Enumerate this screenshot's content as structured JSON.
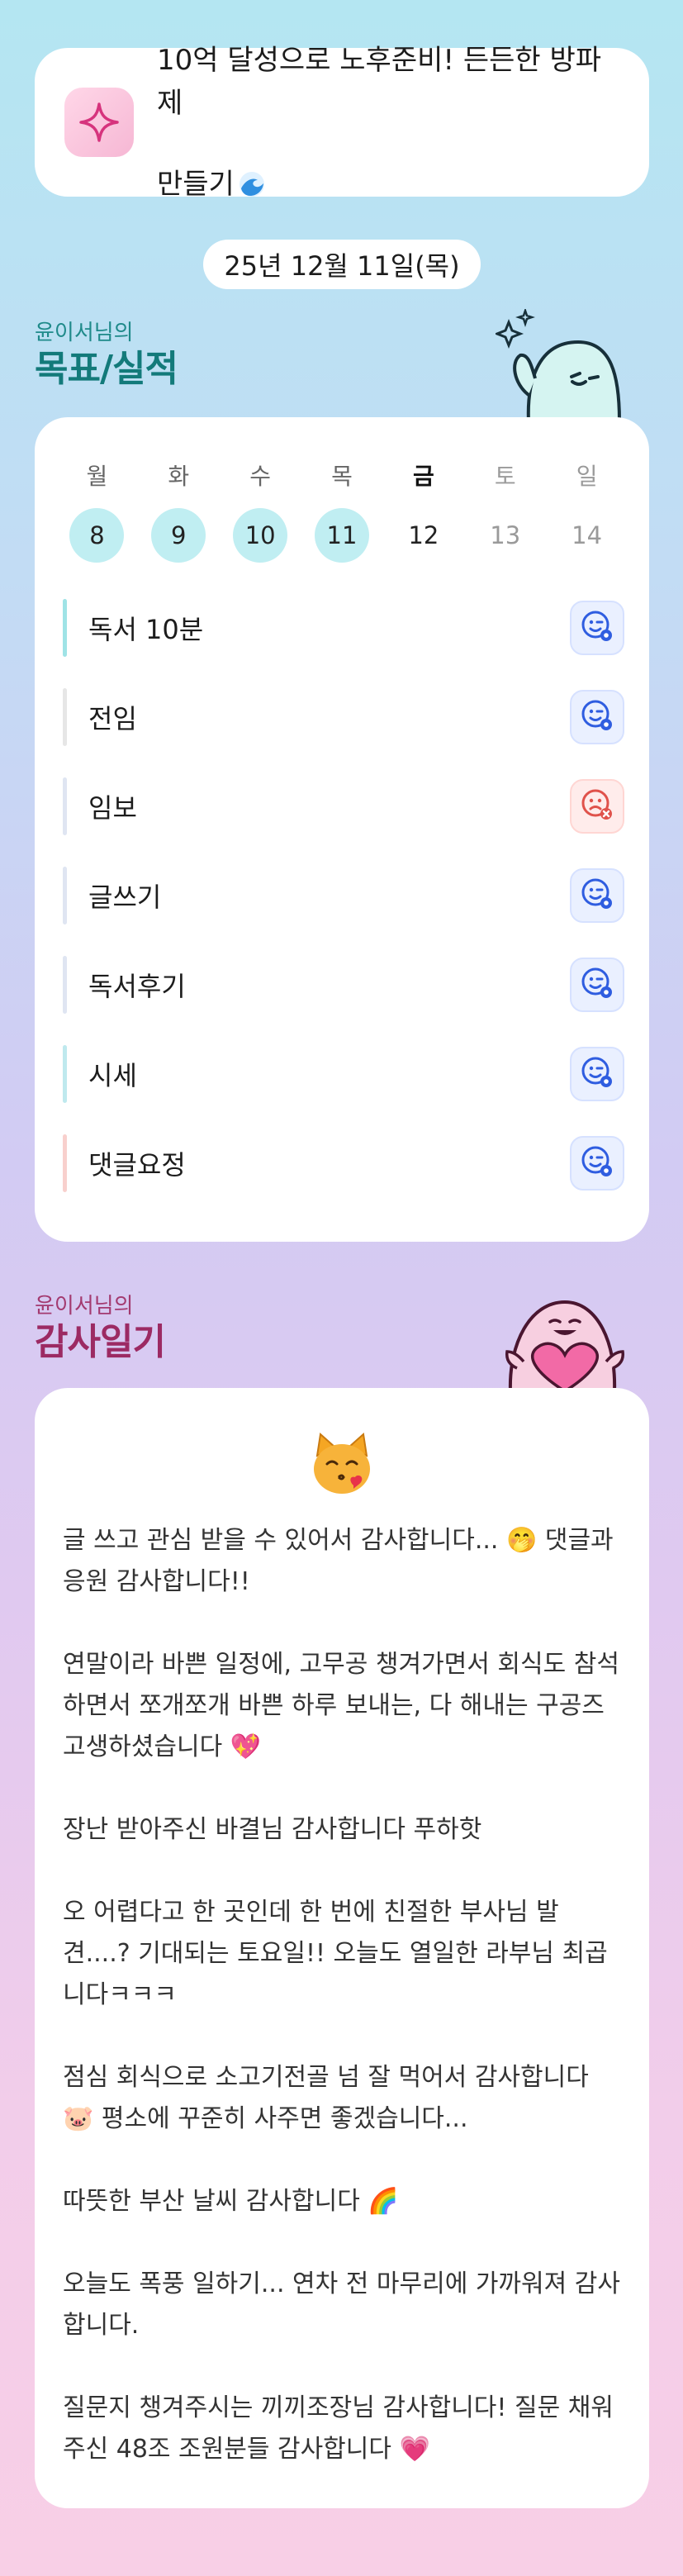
{
  "banner": {
    "icon": "sparkle-icon",
    "text": "10억 달성으로 노후준비! 든든한 방파제\n만들기",
    "emoji": "wave-emoji"
  },
  "date": "25년 12월 11일(목)",
  "goals_section": {
    "owner": "윤이서님의",
    "title": "목표/실적"
  },
  "week": {
    "days": [
      {
        "name": "월",
        "num": "8",
        "state": "done"
      },
      {
        "name": "화",
        "num": "9",
        "state": "done"
      },
      {
        "name": "수",
        "num": "10",
        "state": "done"
      },
      {
        "name": "목",
        "num": "11",
        "state": "done"
      },
      {
        "name": "금",
        "num": "12",
        "state": "today"
      },
      {
        "name": "토",
        "num": "13",
        "state": "future"
      },
      {
        "name": "일",
        "num": "14",
        "state": "future"
      }
    ]
  },
  "goals": [
    {
      "label": "독서 10분",
      "status": "success",
      "color": "#9fe3e6"
    },
    {
      "label": "전임",
      "status": "success",
      "color": "#e6e6e6"
    },
    {
      "label": "임보",
      "status": "fail",
      "color": "#dfe5f2"
    },
    {
      "label": "글쓰기",
      "status": "success",
      "color": "#dfe5f2"
    },
    {
      "label": "독서후기",
      "status": "success",
      "color": "#dfe5f2"
    },
    {
      "label": "시세",
      "status": "success",
      "color": "#bfe9ee"
    },
    {
      "label": "댓글요정",
      "status": "success",
      "color": "#f8d0cd"
    }
  ],
  "diary_section": {
    "owner": "윤이서님의",
    "title": "감사일기"
  },
  "diary": {
    "emoji": "cat-kiss-emoji",
    "paragraphs": [
      "글 쓰고 관심 받을 수 있어서 감사합니다... 🤭 댓글과 응원 감사합니다!!",
      "연말이라 바쁜 일정에, 고무공 챙겨가면서 회식도 참석하면서 쪼개쪼개 바쁜 하루 보내는, 다 해내는 구공즈 고생하셨습니다 💖",
      "장난 받아주신 바결님 감사합니다 푸하핫",
      "오 어렵다고 한 곳인데 한 번에 친절한 부사님 발견....? 기대되는 토요일!! 오늘도 열일한 라부님 최곱니다ㅋㅋㅋ",
      "점심 회식으로 소고기전골 넘 잘 먹어서 감사합니다 🐷 평소에 꾸준히 사주면 좋겠습니다...",
      "따뜻한 부산 날씨 감사합니다 🌈",
      "오늘도 폭풍 일하기... 연차 전 마무리에 가까워져 감사합니다.",
      "질문지 챙겨주시는 끼끼조장님 감사합니다! 질문 채워주신 48조 조원분들 감사합니다 💗"
    ]
  },
  "colors": {
    "teal_title": "#137a7a",
    "pink_title": "#9c2a63",
    "success": "#2f5de0",
    "fail": "#e0524b"
  }
}
